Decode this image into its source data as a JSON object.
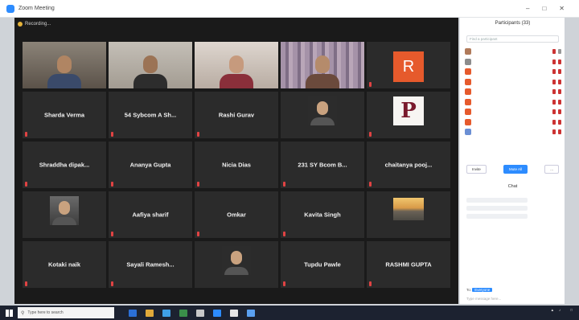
{
  "window": {
    "title": "Zoom Meeting"
  },
  "recording": {
    "label": "Recording..."
  },
  "grid": {
    "tiles": [
      {
        "kind": "video",
        "name": "",
        "scene": "room",
        "head": "#b08563",
        "body": "#3a4a6a",
        "active": true
      },
      {
        "kind": "video",
        "name": "",
        "scene": "wall",
        "head": "#9b7355",
        "body": "#2d2d2d"
      },
      {
        "kind": "video",
        "name": "",
        "scene": "light",
        "head": "#c69a7d",
        "body": "#8a2f3a"
      },
      {
        "kind": "video",
        "name": "",
        "scene": "curtain",
        "head": "#b58b6b",
        "body": "#6b4a3c"
      },
      {
        "kind": "avatar",
        "name": "",
        "initial": "R"
      },
      {
        "kind": "name",
        "name": "Sharda Verma"
      },
      {
        "kind": "name",
        "name": "54 Sybcom A Sh..."
      },
      {
        "kind": "name",
        "name": "Rashi Gurav"
      },
      {
        "kind": "pic",
        "name": "",
        "thumb": "dark"
      },
      {
        "kind": "logo",
        "name": "",
        "initial": "P"
      },
      {
        "kind": "name",
        "name": "Shraddha dipak..."
      },
      {
        "kind": "name",
        "name": "Ananya Gupta"
      },
      {
        "kind": "name",
        "name": "Nicia Dias"
      },
      {
        "kind": "name",
        "name": "231 SY Bcom B..."
      },
      {
        "kind": "name",
        "name": "chaitanya pooj..."
      },
      {
        "kind": "pic",
        "name": "",
        "thumb": "photo"
      },
      {
        "kind": "name",
        "name": "Aafiya sharif"
      },
      {
        "kind": "name",
        "name": "Omkar"
      },
      {
        "kind": "name",
        "name": "Kavita Singh"
      },
      {
        "kind": "pic",
        "name": "",
        "thumb": "sunset"
      },
      {
        "kind": "name",
        "name": "Kotaki naik"
      },
      {
        "kind": "name",
        "name": "Sayali Ramesh..."
      },
      {
        "kind": "pic",
        "name": "",
        "thumb": "dark"
      },
      {
        "kind": "name",
        "name": "Tupdu Pawle"
      },
      {
        "kind": "name",
        "name": "RASHMI GUPTA"
      }
    ]
  },
  "panel": {
    "title": "Participants (33)",
    "search_placeholder": "Find a participant",
    "participants": [
      {
        "name": "",
        "color": "#b07a5a"
      },
      {
        "name": "",
        "color": "#8c8c8c"
      },
      {
        "name": "",
        "color": "#e65a2c"
      },
      {
        "name": "",
        "color": "#e65a2c"
      },
      {
        "name": "",
        "color": "#e65a2c"
      },
      {
        "name": "",
        "color": "#e65a2c"
      },
      {
        "name": "",
        "color": "#e65a2c"
      },
      {
        "name": "",
        "color": "#e65a2c"
      },
      {
        "name": "",
        "color": "#6b8fd4"
      }
    ],
    "buttons": {
      "left": "Invite",
      "middle": "Mute All",
      "right": "..."
    },
    "chat_title": "Chat",
    "messages": [
      {
        "meta": "",
        "text": ""
      },
      {
        "meta": "",
        "text": ""
      },
      {
        "meta": "",
        "text": ""
      }
    ],
    "chat_to_label": "To:",
    "chat_to_value": "Everyone",
    "chat_input_placeholder": "Type message here..."
  },
  "taskbar": {
    "search_placeholder": "Type here to search",
    "apps": [
      "#2b6fd6",
      "#e0a93a",
      "#3fa0e6",
      "#3a8f4a",
      "#c8c8c8",
      "#2d8cff",
      "#e6e6e6",
      "#5aa0f0"
    ],
    "time": "",
    "date": ""
  }
}
